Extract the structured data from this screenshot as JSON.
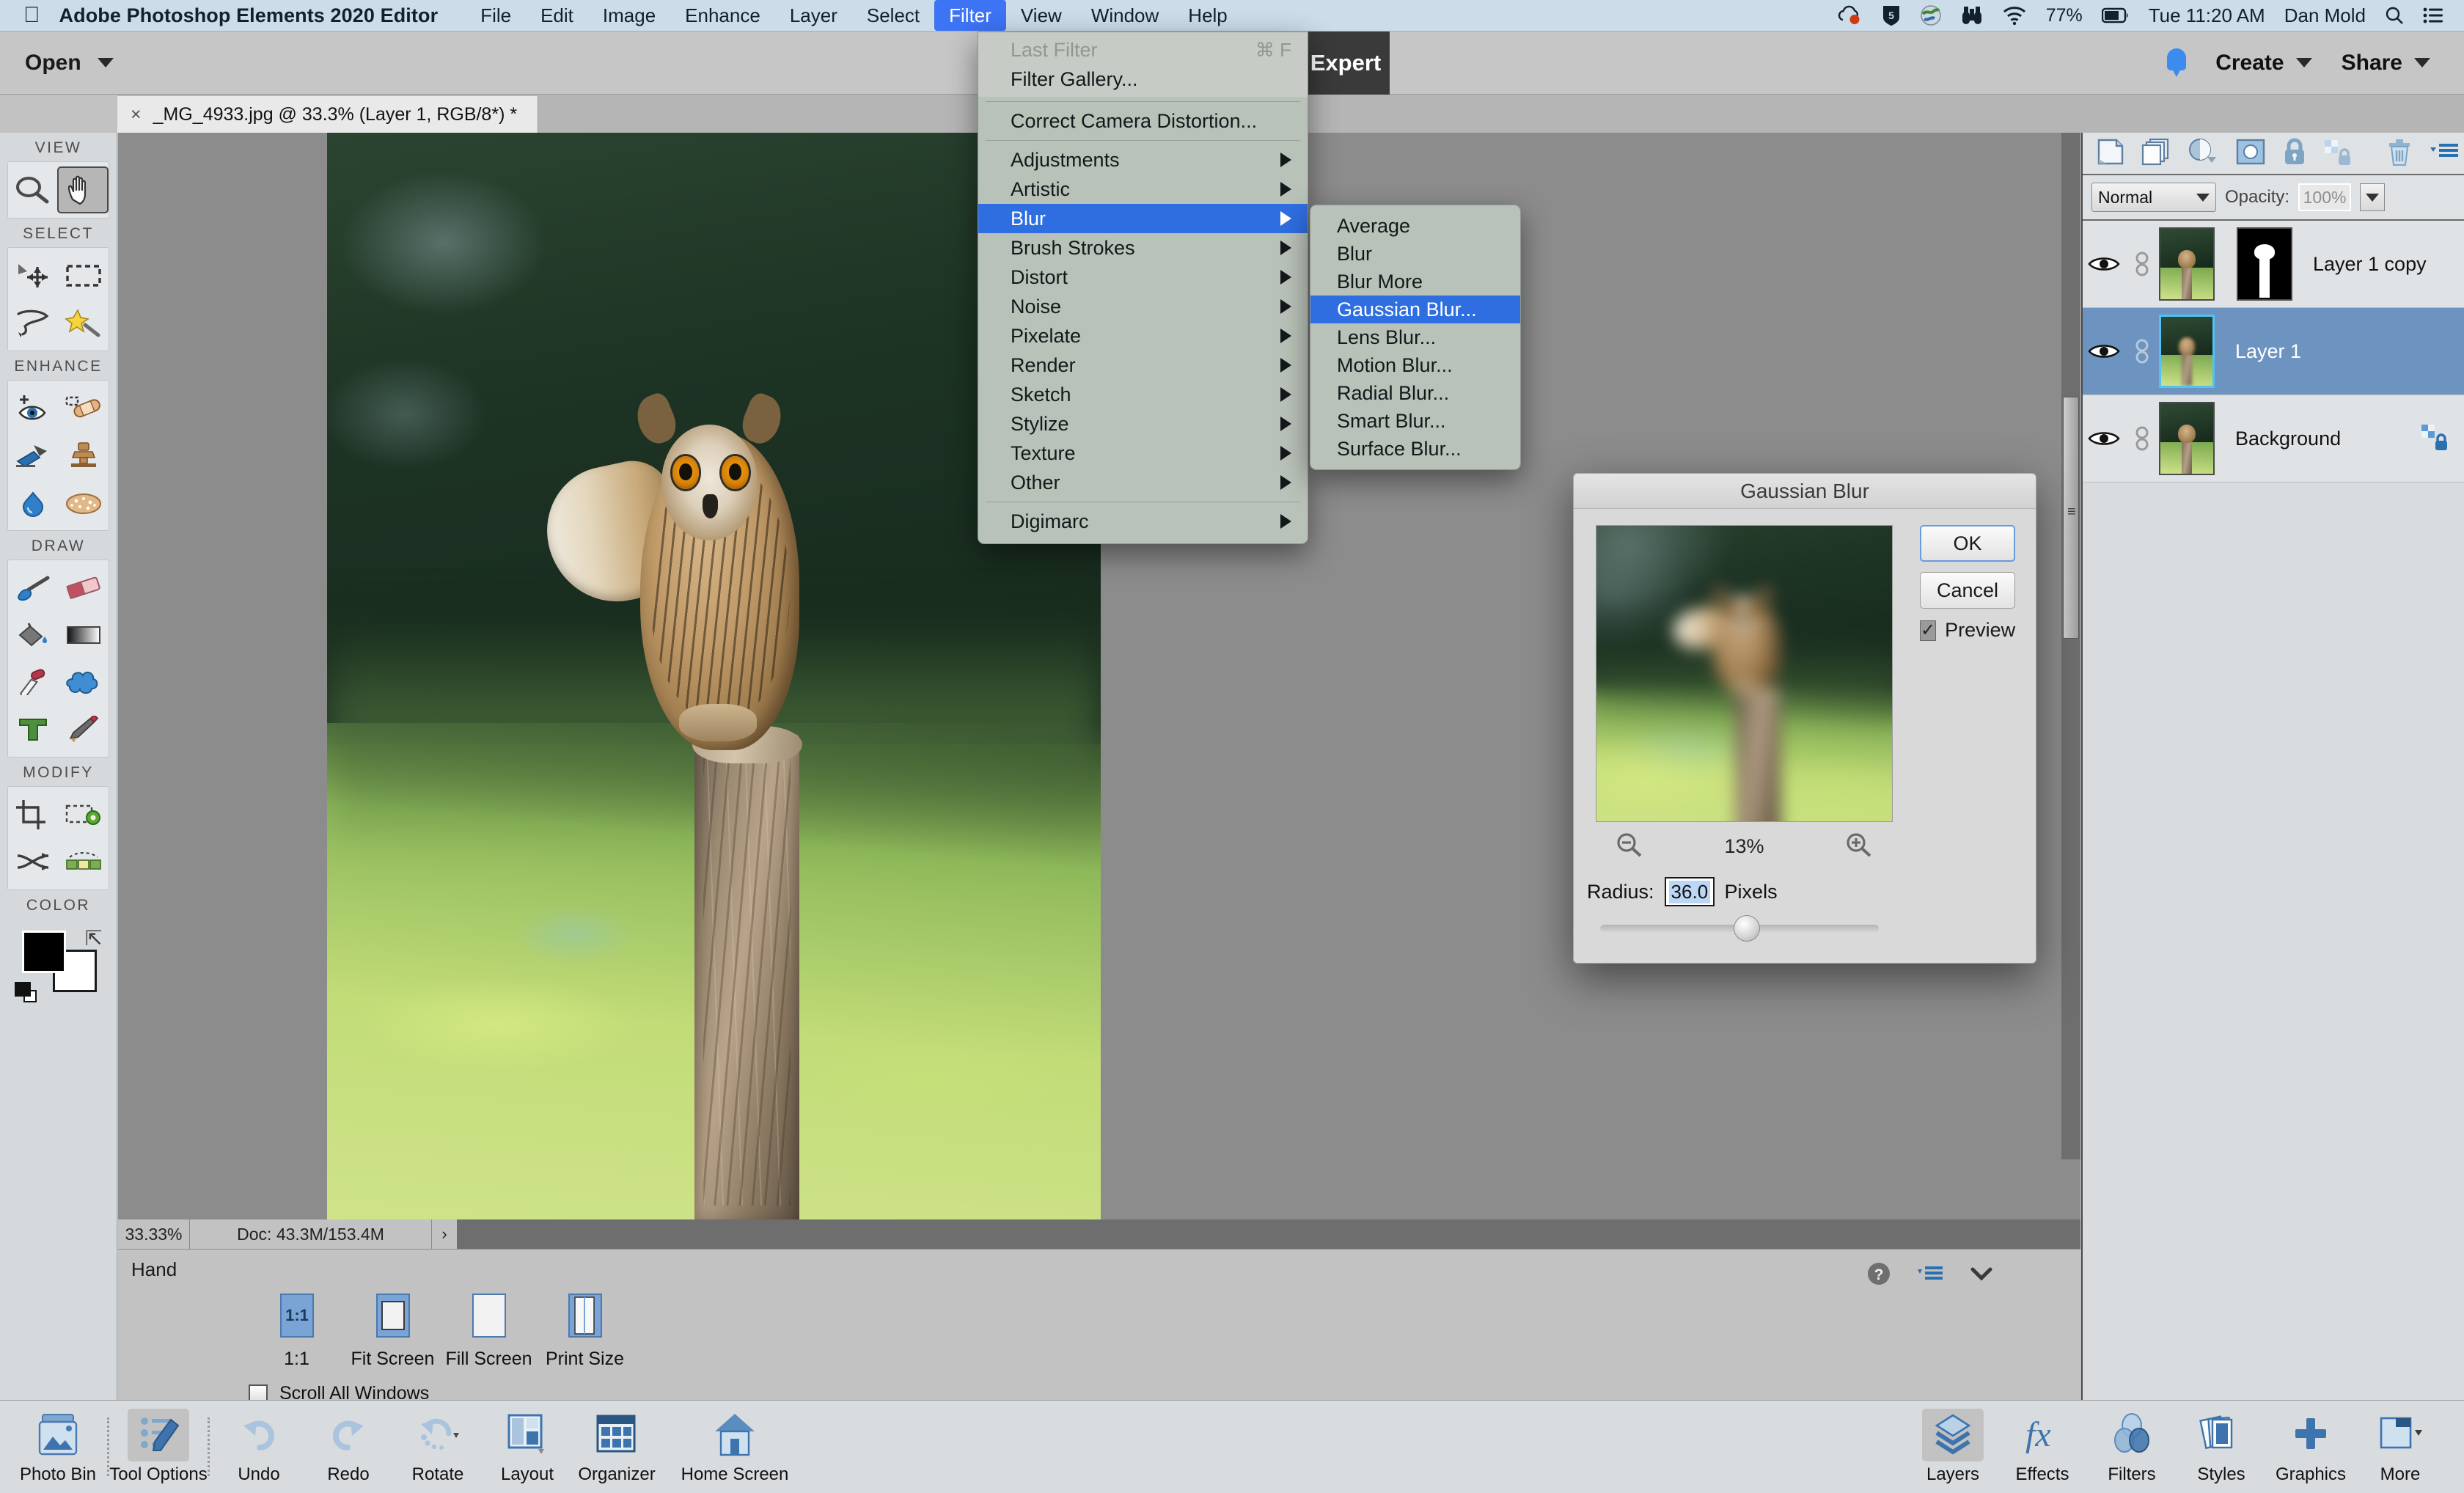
{
  "macbar": {
    "apple": "",
    "app_title": "Adobe Photoshop Elements 2020 Editor",
    "menus": [
      "File",
      "Edit",
      "Image",
      "Enhance",
      "Layer",
      "Select",
      "Filter",
      "View",
      "Window",
      "Help"
    ],
    "active_menu": "Filter",
    "battery_percent": "77%",
    "clock": "Tue 11:20 AM",
    "user": "Dan Mold",
    "status_icons": [
      "creative-cloud-icon",
      "shield-5-icon",
      "globe-icon",
      "binoculars-icon",
      "wifi-icon",
      "battery-icon",
      "spotlight-search-icon",
      "control-center-icon"
    ]
  },
  "appbar": {
    "open_label": "Open",
    "mode_tab": "Expert",
    "create_label": "Create",
    "share_label": "Share",
    "notification_icon": "bell-icon"
  },
  "document": {
    "tab_title": "_MG_4933.jpg @ 33.3% (Layer 1, RGB/8*) *",
    "close_glyph": "×"
  },
  "tools": {
    "groups": [
      {
        "title": "VIEW",
        "items": [
          {
            "name": "zoom-tool",
            "icon": "magnifier-icon",
            "selected": false
          },
          {
            "name": "hand-tool",
            "icon": "hand-icon",
            "selected": true
          }
        ]
      },
      {
        "title": "SELECT",
        "items": [
          {
            "name": "move-tool",
            "icon": "move-arrows-icon",
            "selected": false
          },
          {
            "name": "rectangular-marquee-tool",
            "icon": "dashed-rectangle-icon",
            "selected": false
          },
          {
            "name": "lasso-tool",
            "icon": "lasso-icon",
            "selected": false
          },
          {
            "name": "quick-selection-tool",
            "icon": "magic-wand-sparkle-icon",
            "selected": false
          }
        ]
      },
      {
        "title": "ENHANCE",
        "items": [
          {
            "name": "red-eye-removal-tool",
            "icon": "eye-plus-icon",
            "selected": false
          },
          {
            "name": "spot-healing-brush-tool",
            "icon": "bandage-icon",
            "selected": false
          },
          {
            "name": "smart-brush-tool",
            "icon": "brush-swatch-icon",
            "selected": false
          },
          {
            "name": "clone-stamp-tool",
            "icon": "stamp-icon",
            "selected": false
          },
          {
            "name": "blur-tool",
            "icon": "waterdrop-icon",
            "selected": false
          },
          {
            "name": "sponge-tool",
            "icon": "sponge-icon",
            "selected": false
          }
        ]
      },
      {
        "title": "DRAW",
        "items": [
          {
            "name": "brush-tool",
            "icon": "paintbrush-icon",
            "selected": false
          },
          {
            "name": "eraser-tool",
            "icon": "eraser-icon",
            "selected": false
          },
          {
            "name": "paint-bucket-tool",
            "icon": "paint-bucket-icon",
            "selected": false
          },
          {
            "name": "gradient-tool",
            "icon": "gradient-icon",
            "selected": false
          },
          {
            "name": "color-picker-tool",
            "icon": "eyedropper-icon",
            "selected": false
          },
          {
            "name": "custom-shape-tool",
            "icon": "blob-shape-icon",
            "selected": false
          },
          {
            "name": "type-tool",
            "icon": "type-t-icon",
            "selected": false
          },
          {
            "name": "pencil-tool",
            "icon": "pencil-icon",
            "selected": false
          }
        ]
      },
      {
        "title": "MODIFY",
        "items": [
          {
            "name": "crop-tool",
            "icon": "crop-icon",
            "selected": false
          },
          {
            "name": "recompose-tool",
            "icon": "recompose-gear-icon",
            "selected": false
          },
          {
            "name": "content-aware-move-tool",
            "icon": "swap-arrows-icon",
            "selected": false
          },
          {
            "name": "straighten-tool",
            "icon": "straighten-icon",
            "selected": false
          }
        ]
      }
    ],
    "color_section": {
      "title": "COLOR",
      "foreground": "#000000",
      "background": "#ffffff",
      "swap_icon": "swap-colors-icon",
      "default_icon": "default-colors-icon"
    }
  },
  "filter_menu": {
    "top_items": [
      {
        "label": "Last Filter",
        "shortcut": "⌘ F",
        "disabled": true,
        "submenu": false
      },
      {
        "label": "Filter Gallery...",
        "shortcut": "",
        "disabled": false,
        "submenu": false
      }
    ],
    "camera_item": {
      "label": "Correct Camera Distortion...",
      "submenu": false
    },
    "categories": [
      {
        "label": "Adjustments",
        "submenu": true,
        "highlighted": false
      },
      {
        "label": "Artistic",
        "submenu": true,
        "highlighted": false
      },
      {
        "label": "Blur",
        "submenu": true,
        "highlighted": true
      },
      {
        "label": "Brush Strokes",
        "submenu": true,
        "highlighted": false
      },
      {
        "label": "Distort",
        "submenu": true,
        "highlighted": false
      },
      {
        "label": "Noise",
        "submenu": true,
        "highlighted": false
      },
      {
        "label": "Pixelate",
        "submenu": true,
        "highlighted": false
      },
      {
        "label": "Render",
        "submenu": true,
        "highlighted": false
      },
      {
        "label": "Sketch",
        "submenu": true,
        "highlighted": false
      },
      {
        "label": "Stylize",
        "submenu": true,
        "highlighted": false
      },
      {
        "label": "Texture",
        "submenu": true,
        "highlighted": false
      },
      {
        "label": "Other",
        "submenu": true,
        "highlighted": false
      }
    ],
    "last_item": {
      "label": "Digimarc",
      "submenu": true
    }
  },
  "blur_submenu": {
    "items": [
      {
        "label": "Average",
        "highlighted": false
      },
      {
        "label": "Blur",
        "highlighted": false
      },
      {
        "label": "Blur More",
        "highlighted": false
      },
      {
        "label": "Gaussian Blur...",
        "highlighted": true
      },
      {
        "label": "Lens Blur...",
        "highlighted": false
      },
      {
        "label": "Motion Blur...",
        "highlighted": false
      },
      {
        "label": "Radial Blur...",
        "highlighted": false
      },
      {
        "label": "Smart Blur...",
        "highlighted": false
      },
      {
        "label": "Surface Blur...",
        "highlighted": false
      }
    ]
  },
  "dialog": {
    "title": "Gaussian Blur",
    "ok_label": "OK",
    "cancel_label": "Cancel",
    "preview_label": "Preview",
    "preview_checked": true,
    "zoom_level": "13%",
    "zoom_out_icon": "magnifier-minus-icon",
    "zoom_in_icon": "magnifier-plus-icon",
    "radius_label": "Radius:",
    "radius_value": "36.0",
    "radius_units": "Pixels"
  },
  "status_bar": {
    "zoom": "33.33%",
    "doc_info": "Doc: 43.3M/153.4M",
    "expand_glyph": "›"
  },
  "tool_options": {
    "title": "Hand",
    "buttons": [
      {
        "label": "1:1",
        "icon": "one-to-one-icon",
        "selected": true
      },
      {
        "label": "Fit Screen",
        "icon": "fit-screen-icon",
        "selected": false
      },
      {
        "label": "Fill Screen",
        "icon": "fill-screen-icon",
        "selected": false
      },
      {
        "label": "Print Size",
        "icon": "print-size-icon",
        "selected": false
      }
    ],
    "checkbox_label": "Scroll All Windows",
    "checkbox_checked": false,
    "right_icons": [
      "help-icon",
      "panel-menu-icon",
      "collapse-chevron-icon"
    ]
  },
  "layers_panel": {
    "toolbar_icons": [
      "new-layer-icon",
      "duplicate-layer-icon",
      "adjustment-layer-icon",
      "layer-mask-icon",
      "lock-all-icon",
      "lock-transparency-icon",
      "delete-layer-icon",
      "panel-menu-icon"
    ],
    "blend_mode": "Normal",
    "opacity_label": "Opacity:",
    "opacity_value": "100%",
    "layers": [
      {
        "name": "Layer 1 copy",
        "visible": true,
        "selected": false,
        "has_mask": true,
        "locked": false,
        "linked_mask": true
      },
      {
        "name": "Layer 1",
        "visible": true,
        "selected": true,
        "has_mask": false,
        "locked": false,
        "linked_mask": false
      },
      {
        "name": "Background",
        "visible": true,
        "selected": false,
        "has_mask": false,
        "locked": true,
        "linked_mask": false
      }
    ]
  },
  "taskbar": {
    "left_items": [
      {
        "label": "Photo Bin",
        "icon": "photo-bin-icon",
        "selected": false
      },
      {
        "label": "Tool Options",
        "icon": "tool-options-icon",
        "selected": true
      },
      {
        "label": "Undo",
        "icon": "undo-arrow-icon",
        "selected": false
      },
      {
        "label": "Redo",
        "icon": "redo-arrow-icon",
        "selected": false
      },
      {
        "label": "Rotate",
        "icon": "rotate-icon",
        "selected": false
      },
      {
        "label": "Layout",
        "icon": "layout-icon",
        "selected": false
      },
      {
        "label": "Organizer",
        "icon": "organizer-grid-icon",
        "selected": false
      },
      {
        "label": "Home Screen",
        "icon": "home-icon",
        "selected": false
      }
    ],
    "right_items": [
      {
        "label": "Layers",
        "icon": "layers-diamond-icon",
        "selected": true
      },
      {
        "label": "Effects",
        "icon": "fx-icon",
        "selected": false
      },
      {
        "label": "Filters",
        "icon": "filters-venn-icon",
        "selected": false
      },
      {
        "label": "Styles",
        "icon": "styles-stack-icon",
        "selected": false
      },
      {
        "label": "Graphics",
        "icon": "plus-icon",
        "selected": false
      },
      {
        "label": "More",
        "icon": "more-panel-icon",
        "selected": false
      }
    ]
  },
  "colors": {
    "menu_highlight": "#2f6ee0",
    "macbar_bg": "#ccdce9",
    "panel_bg": "#d9dcdf",
    "canvas_bg": "#8c8c8c",
    "layer_selected": "#6d93c0",
    "accent_blue": "#3c8cf0"
  }
}
